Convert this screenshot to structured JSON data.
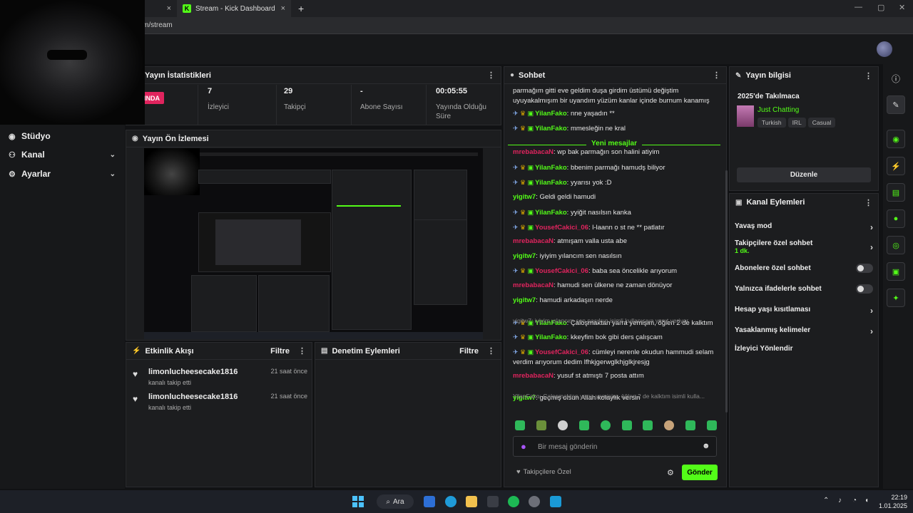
{
  "browser": {
    "tab1_close": "×",
    "tab2_title": "Stream - Kick Dashboard",
    "tab2_favicon": "K",
    "new_tab": "+",
    "url": "m/stream"
  },
  "sidebar": {
    "items": [
      {
        "label": "Stüdyo",
        "icon": "studio-icon",
        "has_chevron": false
      },
      {
        "label": "Kanal",
        "icon": "users-icon",
        "has_chevron": true
      },
      {
        "label": "Ayarlar",
        "icon": "gear-icon",
        "has_chevron": true
      }
    ]
  },
  "stats": {
    "title": "Yayın İstatistikleri",
    "live_badge": "YINDA",
    "live_label": "n",
    "viewers_value": "7",
    "viewers_label": "İzleyici",
    "followers_value": "29",
    "followers_label": "Takipçi",
    "subs_value": "-",
    "subs_label": "Abone Sayısı",
    "duration_value": "00:05:55",
    "duration_label": "Yayında Olduğu Süre"
  },
  "preview": {
    "title": "Yayın Ön İzlemesi"
  },
  "activity": {
    "title": "Etkinlik Akışı",
    "filter": "Filtre",
    "events": [
      {
        "user": "limonlucheesecake1816",
        "action": "kanalı takip etti",
        "time": "21 saat önce"
      },
      {
        "user": "limonlucheesecake1816",
        "action": "kanalı takip etti",
        "time": "21 saat önce"
      }
    ]
  },
  "moderation": {
    "title": "Denetim Eylemleri",
    "filter": "Filtre"
  },
  "chat": {
    "title": "Sohbet",
    "top_text": "parmağım gitti eve geldim duşa girdim üstümü değiştim uyuyakalmışım bir uyandım yüzüm kanlar içinde burnum kanamış",
    "new_messages": "Yeni mesajlar",
    "messages": [
      {
        "user": "YilanFako",
        "text": ": nne yaşadın **",
        "badges": true,
        "color": "#53fc18"
      },
      {
        "user": "YilanFako",
        "text": ": mmesleğin ne kral",
        "badges": true,
        "color": "#53fc18"
      },
      {
        "user": "mrebabacaN",
        "text": ": wp bak parmağın son halini atiyim",
        "badges": false,
        "color": "#e0245e"
      },
      {
        "user": "YilanFako",
        "text": ": bbenim parmağı hamudş biliyor",
        "badges": true,
        "color": "#53fc18"
      },
      {
        "user": "YilanFako",
        "text": ": yyarısı yok :D",
        "badges": true,
        "color": "#53fc18"
      },
      {
        "user": "yigitw7",
        "text": ": Geldi geldi hamudi",
        "badges": false,
        "color": "#53fc18"
      },
      {
        "user": "YilanFako",
        "text": ": yyiğit nasılsın kanka",
        "badges": true,
        "color": "#53fc18"
      },
      {
        "user": "YousefCakici_06",
        "text": ": l-laann o st ne ** patlatır",
        "badges": true,
        "color": "#e0245e"
      },
      {
        "user": "mrebabacaN",
        "text": ": atmışam valla usta abe",
        "badges": false,
        "color": "#e0245e"
      },
      {
        "user": "yigitw7",
        "text": ": iyiyim yılancım sen nasılsın",
        "badges": false,
        "color": "#53fc18"
      },
      {
        "user": "YousefCakici_06",
        "text": ": baba sea öncelikle arıyorum",
        "badges": true,
        "color": "#e0245e"
      },
      {
        "user": "mrebabacaN",
        "text": ": hamudi sen ülkene ne zaman dönüyor",
        "badges": false,
        "color": "#e0245e"
      },
      {
        "user": "yigitw7",
        "text": ": hamudi arkadaşın nerde",
        "badges": false,
        "color": "#53fc18"
      },
      {
        "user": "YilanFako",
        "text": ": Çaloşmaktan yarra yemişim, öğlen 2 de kalktım",
        "badges": true,
        "color": "#53fc18"
      },
      {
        "user": "YilanFako",
        "text": ": kkeyfim bok gibi ders çalışcam",
        "badges": true,
        "color": "#53fc18"
      },
      {
        "user": "YousefCakici_06",
        "text": ": cümleyi nerenle okudun hammudi selam verdim arıyorum dedim lfhkjgerwglkhjglkjresjg",
        "badges": true,
        "color": "#e0245e"
      },
      {
        "user": "mrebabacaN",
        "text": ": yusuf st atmıştı 7 posta attım",
        "badges": false,
        "color": "#e0245e"
      },
      {
        "user": "yigitw7",
        "text": ": geçmiş olsun Allah kolaylık versin",
        "badges": false,
        "color": "#53fc18"
      }
    ],
    "reply1": "yigitw7: iyiyim yılancım sen nasılsın isimli kullanıcıya yanıt veriyor",
    "reply2": "YilanFako: Çaloşmaktan yarra yemişim, öğlen 2 de kalktım isimli kulla...",
    "input_placeholder": "Bir mesaj gönderin",
    "followers_only": "Takipçilere Özel",
    "send": "Gönder"
  },
  "stream_info": {
    "title": "Yayın bilgisi",
    "stream_title": "2025'de Takılmaca",
    "category": "Just Chatting",
    "tags": [
      "Turkish",
      "IRL",
      "Casual"
    ],
    "edit": "Düzenle"
  },
  "channel_actions": {
    "title": "Kanal Eylemleri",
    "slow_mode": "Yavaş mod",
    "followers_chat": "Takipçilere özel sohbet",
    "followers_chat_sub": "1 dk.",
    "subs_chat": "Abonelere özel sohbet",
    "emote_chat": "Yalnızca ifadelerle sohbet",
    "account_age": "Hesap yaşı kısıtlaması",
    "banned_words": "Yasaklanmış kelimeler",
    "redirect": "İzleyici Yönlendir"
  },
  "taskbar": {
    "search": "Ara",
    "time": "22:19",
    "date": "1.01.2025"
  }
}
